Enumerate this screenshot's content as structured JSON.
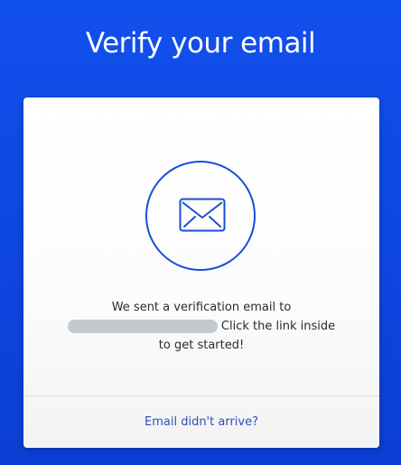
{
  "header": {
    "title": "Verify your email"
  },
  "card": {
    "icon": "envelope-icon",
    "message_line1": "We sent a verification email to",
    "message_line2_suffix": "Click the link inside",
    "message_line3": "to get started!",
    "help_link": "Email didn't arrive?"
  },
  "colors": {
    "background": "#1250ec",
    "accent": "#1a4dd6",
    "link": "#2f4fb8"
  }
}
